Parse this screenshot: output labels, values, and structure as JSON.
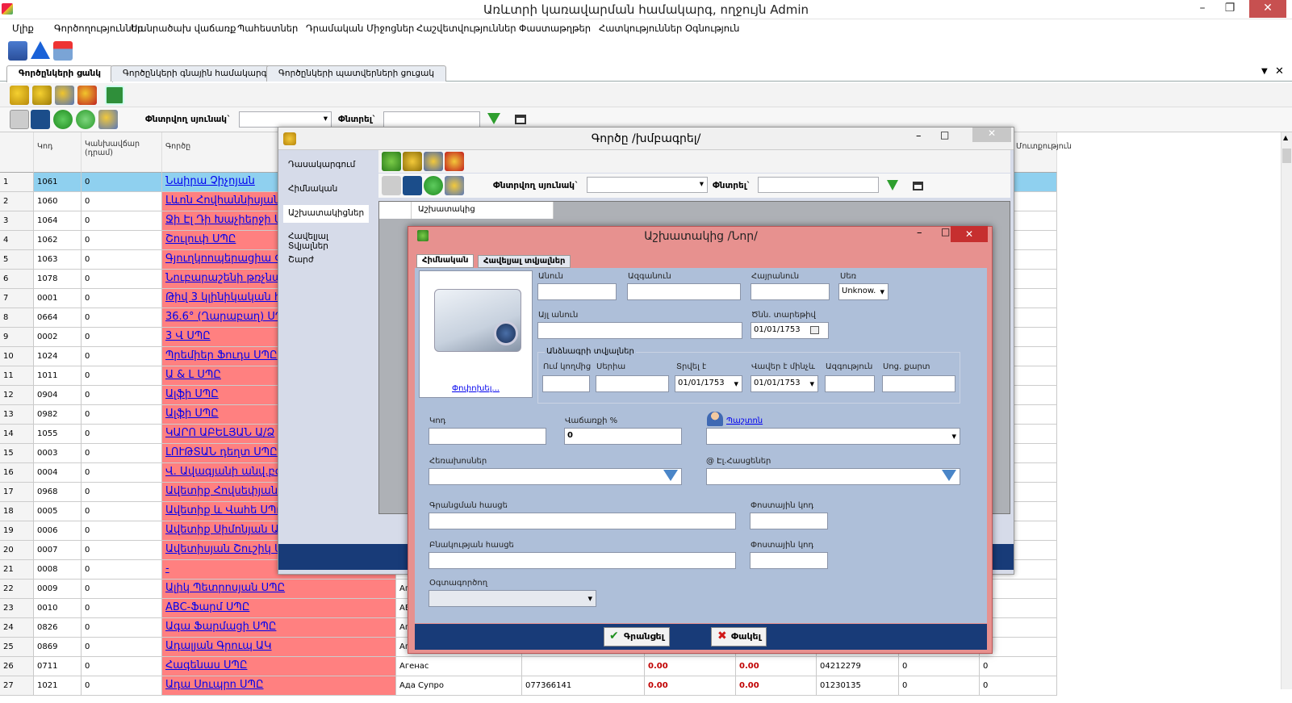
{
  "app": {
    "title": "Առևտրի կառավարման համակարգ, ողջույն Admin"
  },
  "menu": [
    "Մլիք",
    "Գործողություններ",
    "Սանրածախ վաճառք",
    "Պահեստներ",
    "Դրամական Միջոցներ",
    "Հաշվետվություններ",
    "Փաստաթղթեր",
    "Հատկություններ",
    "Օգնություն"
  ],
  "tabs": [
    "Գործընկերի ցանկ",
    "Գործընկերի գնային համակարգ",
    "Գործընկերի պատվերների ցուցակ"
  ],
  "filter": {
    "column_label": "Փնտրվող սյունակ`",
    "search_label": "Փնտրել`"
  },
  "grid": {
    "headers": [
      "Կոդ",
      "Կանխավճար (դրամ)",
      "Գործը",
      "",
      "",
      "",
      "",
      "",
      "",
      "",
      "Մուտքություն"
    ],
    "rows": [
      [
        "1",
        "1061",
        "0",
        "Նաիրա Չիչոյան"
      ],
      [
        "2",
        "1060",
        "0",
        "Լևոն Հովհաննիսյան"
      ],
      [
        "3",
        "1064",
        "0",
        "Ջի Էլ Դի Խաչիերջի ՍՊԸ"
      ],
      [
        "4",
        "1062",
        "0",
        "Շուլուփ ՍՊԸ"
      ],
      [
        "5",
        "1063",
        "0",
        "Գյուղկոոպերացիա ՓԲԸ"
      ],
      [
        "6",
        "1078",
        "0",
        "Նուբարաշենի թռչնաֆաբրիկա"
      ],
      [
        "7",
        "0001",
        "0",
        "Թիվ 3 կլինիկական հիվանդանոց"
      ],
      [
        "8",
        "0664",
        "0",
        "36.6° (Ղարաբաղ) ՍՊԸ"
      ],
      [
        "9",
        "0002",
        "0",
        "3 Վ ՍՊԸ"
      ],
      [
        "10",
        "1024",
        "0",
        "Պրեմիեր Ֆուդս ՍՊԸ"
      ],
      [
        "11",
        "1011",
        "0",
        "Ա & Լ ՍՊԸ"
      ],
      [
        "12",
        "0904",
        "0",
        "Ալֆի ՍՊԸ"
      ],
      [
        "13",
        "0982",
        "0",
        "Ալֆի ՍՊԸ"
      ],
      [
        "14",
        "1055",
        "0",
        "ԿԱՐՈ ԱԲԵԼՅԱՆ Ա/Ձ"
      ],
      [
        "15",
        "0003",
        "0",
        "ԼՈՒԹՏԱՆ դեղտ ՍՊԸ"
      ],
      [
        "16",
        "0004",
        "0",
        "Վ. Ավագյանի անվ.բժշ."
      ],
      [
        "17",
        "0968",
        "0",
        "Ավետիք Հովսեփյանի Ա/Ձ"
      ],
      [
        "18",
        "0005",
        "0",
        "Ավետիք և Վահե ՍՊԸ"
      ],
      [
        "19",
        "0006",
        "0",
        "Ավետիք Սիմոնյան Ա/Ձ"
      ],
      [
        "20",
        "0007",
        "0",
        "Ավետիսյան Շուշիկ Ա/Ձ"
      ],
      [
        "21",
        "0008",
        "0",
        "-"
      ],
      [
        "22",
        "0009",
        "0",
        "Ալիկ Պետրոսյան ՍՊԸ",
        "Аг"
      ],
      [
        "23",
        "0010",
        "0",
        "ABC-Ֆարմ ՍՊԸ",
        "АЕ"
      ],
      [
        "24",
        "0826",
        "0",
        "Ագա Ֆարմացի ՍՊԸ",
        "Аг"
      ],
      [
        "25",
        "0869",
        "0",
        "Ադալյան Գրուպ ԱԿ",
        "Аг"
      ],
      [
        "26",
        "0711",
        "0",
        "Հագենաս ՍՊԸ",
        "Агенас",
        "",
        "0.00",
        "0.00",
        "04212279",
        "0",
        "0"
      ],
      [
        "27",
        "1021",
        "0",
        "Ադա Սուպրո ՍՊԸ",
        "Ада Супро",
        "077366141",
        "0.00",
        "0.00",
        "01230135",
        "0",
        "0"
      ]
    ]
  },
  "win1": {
    "title": "Գործը /խմբագրել/",
    "side": [
      "Դասակարգում",
      "Հիմնական",
      "Աշխատակիցներ",
      "Հավելյալ Տվյալներ",
      "Շարժ"
    ],
    "column_label": "Փնտրվող սյունակ`",
    "search_label": "Փնտրել`",
    "grid_header": "Աշխատակից"
  },
  "win2": {
    "title": "Աշխատակից /Նոր/",
    "tabs": [
      "Հիմնական",
      "Հավելյալ տվյալներ"
    ],
    "photo_link": "Փոփոխել...",
    "labels": {
      "first": "Անուն",
      "last": "Ազգանուն",
      "middle": "Հայրանուն",
      "sex": "Սեռ",
      "other_name": "Այլ անուն",
      "birth": "Ծնն. տարեթիվ",
      "passport_group": "Անձնագրի տվյալներ",
      "issued_by": "Ում կողմից",
      "series": "Սերիա",
      "issued": "Տրվել է",
      "valid": "Վավեր է մինչև",
      "nationality": "Ազգություն",
      "soc": "Սոց. քարտ",
      "code": "Կոդ",
      "discount": "Վաճառքի %",
      "position": "Պաշտոն",
      "phones": "Հեռախոսներ",
      "emails": "@ Էլ.Հասցեներ",
      "reg_addr": "Գրանցման հասցե",
      "post1": "Փոստային կոդ",
      "res_addr": "Բնակության հասցե",
      "post2": "Փոստային կոդ",
      "user": "Օգտագործող"
    },
    "values": {
      "sex": "Unknow.",
      "birth": "01/01/1753",
      "issued": "01/01/1753",
      "valid": "01/01/1753",
      "discount": "0"
    },
    "buttons": {
      "save": "Գրանցել",
      "close": "Փակել"
    }
  }
}
